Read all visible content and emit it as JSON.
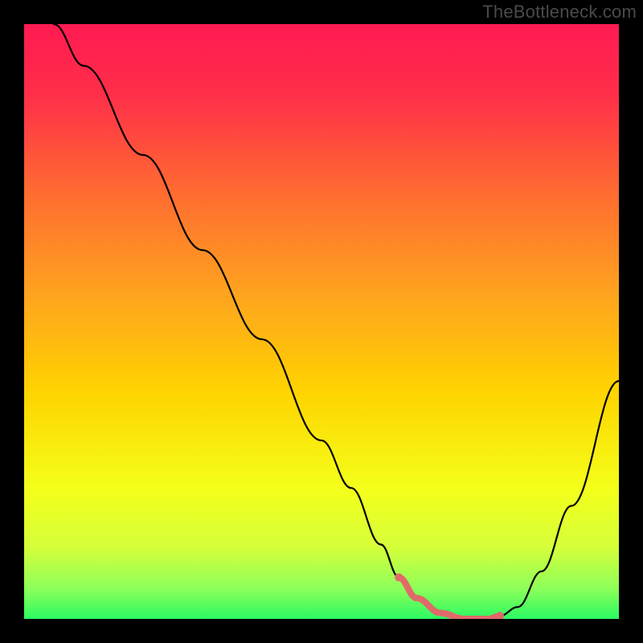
{
  "watermark": "TheBottleneck.com",
  "colors": {
    "frame": "#000000",
    "gradient_stops": [
      {
        "offset": 0.0,
        "color": "#ff1a52"
      },
      {
        "offset": 0.12,
        "color": "#ff2f49"
      },
      {
        "offset": 0.28,
        "color": "#ff6a31"
      },
      {
        "offset": 0.45,
        "color": "#ffa21f"
      },
      {
        "offset": 0.62,
        "color": "#ffd400"
      },
      {
        "offset": 0.78,
        "color": "#f4ff1a"
      },
      {
        "offset": 0.88,
        "color": "#d5ff3a"
      },
      {
        "offset": 0.95,
        "color": "#8cff5a"
      },
      {
        "offset": 1.0,
        "color": "#2bfa62"
      }
    ],
    "curve": "#000000",
    "highlight": "#e06a6a"
  },
  "chart_data": {
    "type": "line",
    "title": "",
    "xlabel": "",
    "ylabel": "",
    "xlim": [
      0,
      1
    ],
    "ylim": [
      0,
      1
    ],
    "series": [
      {
        "name": "curve",
        "x": [
          0.05,
          0.1,
          0.2,
          0.3,
          0.4,
          0.5,
          0.55,
          0.6,
          0.63,
          0.66,
          0.7,
          0.74,
          0.78,
          0.8,
          0.83,
          0.87,
          0.92,
          1.0
        ],
        "y": [
          1.0,
          0.93,
          0.78,
          0.62,
          0.47,
          0.3,
          0.22,
          0.125,
          0.07,
          0.035,
          0.01,
          0.0,
          0.0,
          0.005,
          0.02,
          0.08,
          0.19,
          0.4
        ]
      },
      {
        "name": "highlight-segment",
        "x": [
          0.63,
          0.66,
          0.7,
          0.74,
          0.78,
          0.8
        ],
        "y": [
          0.07,
          0.035,
          0.01,
          0.0,
          0.0,
          0.005
        ]
      }
    ],
    "annotations": []
  }
}
